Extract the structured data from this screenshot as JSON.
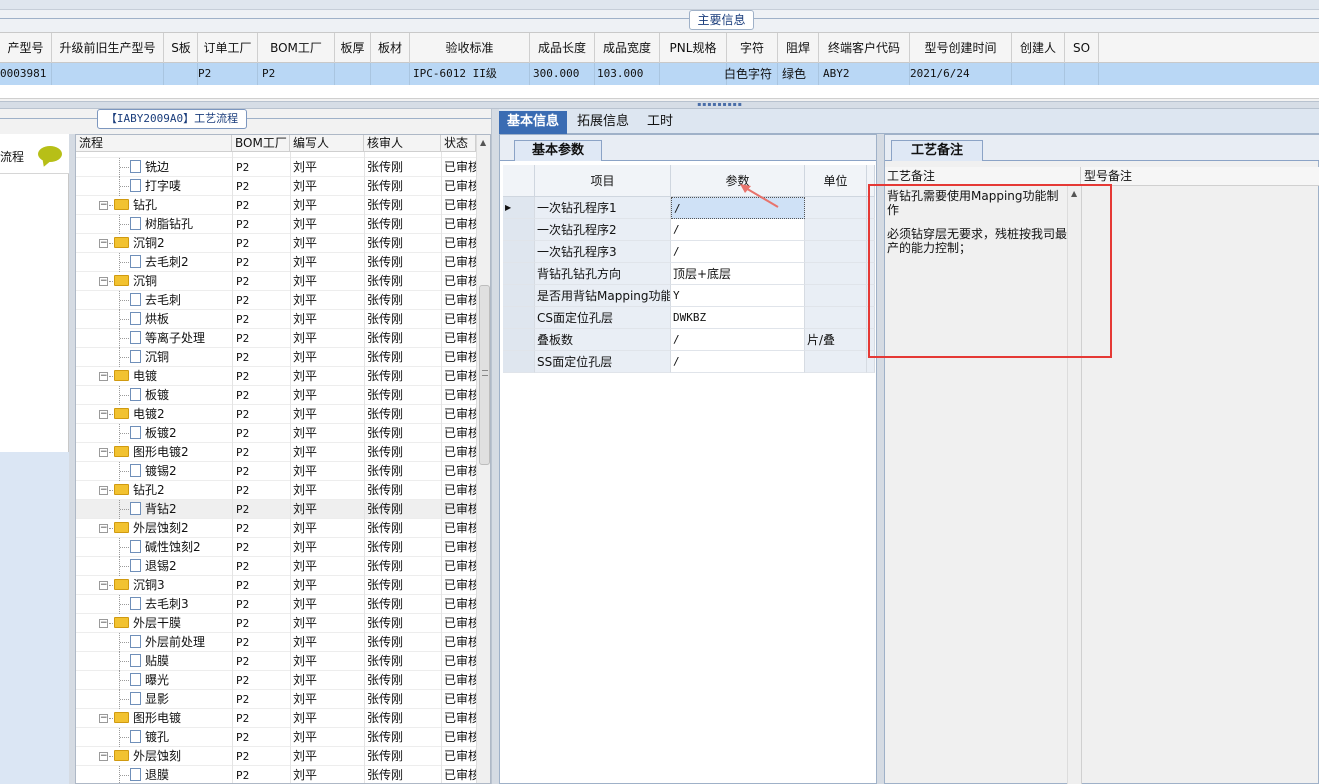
{
  "main_section": {
    "title": "主要信息",
    "columns": [
      "产型号",
      "升级前旧生产型号",
      "S板",
      "订单工厂",
      "BOM工厂",
      "板厚",
      "板材",
      "验收标准",
      "成品长度",
      "成品宽度",
      "PNL规格",
      "字符",
      "阻焊",
      "终端客户代码",
      "型号创建时间",
      "创建人",
      "SO"
    ],
    "row": {
      "model": "0003981",
      "order_factory": "P2",
      "bom_factory": "P2",
      "standard": "IPC-6012 II级",
      "length": "300.000",
      "width": "103.000",
      "character": "白色字符",
      "solder_mask": "绿色",
      "customer_code": "ABY2",
      "created": "2021/6/24"
    }
  },
  "process_panel": {
    "title": "【IABY2009A0】工艺流程",
    "side_label": "流程",
    "columns": [
      "流程",
      "BOM工厂",
      "编写人",
      "核审人",
      "状态"
    ],
    "rows": [
      {
        "name": "铣边",
        "level": 2,
        "bom": "P2",
        "writer": "刘平",
        "reviewer": "张传刚",
        "status": "已审核"
      },
      {
        "name": "打字唛",
        "level": 2,
        "bom": "P2",
        "writer": "刘平",
        "reviewer": "张传刚",
        "status": "已审核"
      },
      {
        "name": "钻孔",
        "level": 1,
        "bom": "P2",
        "writer": "刘平",
        "reviewer": "张传刚",
        "status": "已审核"
      },
      {
        "name": "树脂钻孔",
        "level": 2,
        "bom": "P2",
        "writer": "刘平",
        "reviewer": "张传刚",
        "status": "已审核"
      },
      {
        "name": "沉铜2",
        "level": 1,
        "bom": "P2",
        "writer": "刘平",
        "reviewer": "张传刚",
        "status": "已审核"
      },
      {
        "name": "去毛刺2",
        "level": 2,
        "bom": "P2",
        "writer": "刘平",
        "reviewer": "张传刚",
        "status": "已审核"
      },
      {
        "name": "沉铜",
        "level": 1,
        "bom": "P2",
        "writer": "刘平",
        "reviewer": "张传刚",
        "status": "已审核"
      },
      {
        "name": "去毛刺",
        "level": 2,
        "bom": "P2",
        "writer": "刘平",
        "reviewer": "张传刚",
        "status": "已审核"
      },
      {
        "name": "烘板",
        "level": 2,
        "bom": "P2",
        "writer": "刘平",
        "reviewer": "张传刚",
        "status": "已审核"
      },
      {
        "name": "等离子处理",
        "level": 2,
        "bom": "P2",
        "writer": "刘平",
        "reviewer": "张传刚",
        "status": "已审核"
      },
      {
        "name": "沉铜",
        "level": 2,
        "bom": "P2",
        "writer": "刘平",
        "reviewer": "张传刚",
        "status": "已审核"
      },
      {
        "name": "电镀",
        "level": 1,
        "bom": "P2",
        "writer": "刘平",
        "reviewer": "张传刚",
        "status": "已审核"
      },
      {
        "name": "板镀",
        "level": 2,
        "bom": "P2",
        "writer": "刘平",
        "reviewer": "张传刚",
        "status": "已审核"
      },
      {
        "name": "电镀2",
        "level": 1,
        "bom": "P2",
        "writer": "刘平",
        "reviewer": "张传刚",
        "status": "已审核"
      },
      {
        "name": "板镀2",
        "level": 2,
        "bom": "P2",
        "writer": "刘平",
        "reviewer": "张传刚",
        "status": "已审核"
      },
      {
        "name": "图形电镀2",
        "level": 1,
        "bom": "P2",
        "writer": "刘平",
        "reviewer": "张传刚",
        "status": "已审核"
      },
      {
        "name": "镀锡2",
        "level": 2,
        "bom": "P2",
        "writer": "刘平",
        "reviewer": "张传刚",
        "status": "已审核"
      },
      {
        "name": "钻孔2",
        "level": 1,
        "bom": "P2",
        "writer": "刘平",
        "reviewer": "张传刚",
        "status": "已审核"
      },
      {
        "name": "背钻2",
        "level": 2,
        "bom": "P2",
        "writer": "刘平",
        "reviewer": "张传刚",
        "status": "已审核",
        "selected": true
      },
      {
        "name": "外层蚀刻2",
        "level": 1,
        "bom": "P2",
        "writer": "刘平",
        "reviewer": "张传刚",
        "status": "已审核"
      },
      {
        "name": "碱性蚀刻2",
        "level": 2,
        "bom": "P2",
        "writer": "刘平",
        "reviewer": "张传刚",
        "status": "已审核"
      },
      {
        "name": "退锡2",
        "level": 2,
        "bom": "P2",
        "writer": "刘平",
        "reviewer": "张传刚",
        "status": "已审核"
      },
      {
        "name": "沉铜3",
        "level": 1,
        "bom": "P2",
        "writer": "刘平",
        "reviewer": "张传刚",
        "status": "已审核"
      },
      {
        "name": "去毛刺3",
        "level": 2,
        "bom": "P2",
        "writer": "刘平",
        "reviewer": "张传刚",
        "status": "已审核"
      },
      {
        "name": "外层干膜",
        "level": 1,
        "bom": "P2",
        "writer": "刘平",
        "reviewer": "张传刚",
        "status": "已审核"
      },
      {
        "name": "外层前处理",
        "level": 2,
        "bom": "P2",
        "writer": "刘平",
        "reviewer": "张传刚",
        "status": "已审核"
      },
      {
        "name": "贴膜",
        "level": 2,
        "bom": "P2",
        "writer": "刘平",
        "reviewer": "张传刚",
        "status": "已审核"
      },
      {
        "name": "曝光",
        "level": 2,
        "bom": "P2",
        "writer": "刘平",
        "reviewer": "张传刚",
        "status": "已审核"
      },
      {
        "name": "显影",
        "level": 2,
        "bom": "P2",
        "writer": "刘平",
        "reviewer": "张传刚",
        "status": "已审核"
      },
      {
        "name": "图形电镀",
        "level": 1,
        "bom": "P2",
        "writer": "刘平",
        "reviewer": "张传刚",
        "status": "已审核"
      },
      {
        "name": "镀孔",
        "level": 2,
        "bom": "P2",
        "writer": "刘平",
        "reviewer": "张传刚",
        "status": "已审核"
      },
      {
        "name": "外层蚀刻",
        "level": 1,
        "bom": "P2",
        "writer": "刘平",
        "reviewer": "张传刚",
        "status": "已审核"
      },
      {
        "name": "退膜",
        "level": 2,
        "bom": "P2",
        "writer": "刘平",
        "reviewer": "张传刚",
        "status": "已审核"
      }
    ]
  },
  "tabs": [
    "基本信息",
    "拓展信息",
    "工时"
  ],
  "basic_params": {
    "tab_label": "基本参数",
    "columns": [
      "项目",
      "参数",
      "单位"
    ],
    "rows": [
      {
        "item": "一次钻孔程序1",
        "value": "/",
        "unit": "",
        "selected": true
      },
      {
        "item": "一次钻孔程序2",
        "value": "/",
        "unit": ""
      },
      {
        "item": "一次钻孔程序3",
        "value": "/",
        "unit": ""
      },
      {
        "item": "背钻孔钻孔方向",
        "value": "顶层+底层",
        "unit": "",
        "cn": true
      },
      {
        "item": "是否用背钻Mapping功能",
        "value": "Y",
        "unit": ""
      },
      {
        "item": "CS面定位孔层",
        "value": "DWKBZ",
        "unit": ""
      },
      {
        "item": "叠板数",
        "value": "/",
        "unit": "片/叠"
      },
      {
        "item": "SS面定位孔层",
        "value": "/",
        "unit": ""
      }
    ]
  },
  "notes": {
    "tab_label": "工艺备注",
    "col1": "工艺备注",
    "col2": "型号备注",
    "line1": "背钻孔需要使用Mapping功能制作",
    "line2": "必须钻穿层无要求，残桩按我司最产的能力控制；"
  },
  "colors": {
    "accent": "#3a6cb3",
    "selection": "#b9d7f5",
    "highlight_box": "#e53935"
  },
  "icons": [
    "folder-icon",
    "document-icon",
    "chat-bubble-icon",
    "arrow-annotation-icon"
  ]
}
